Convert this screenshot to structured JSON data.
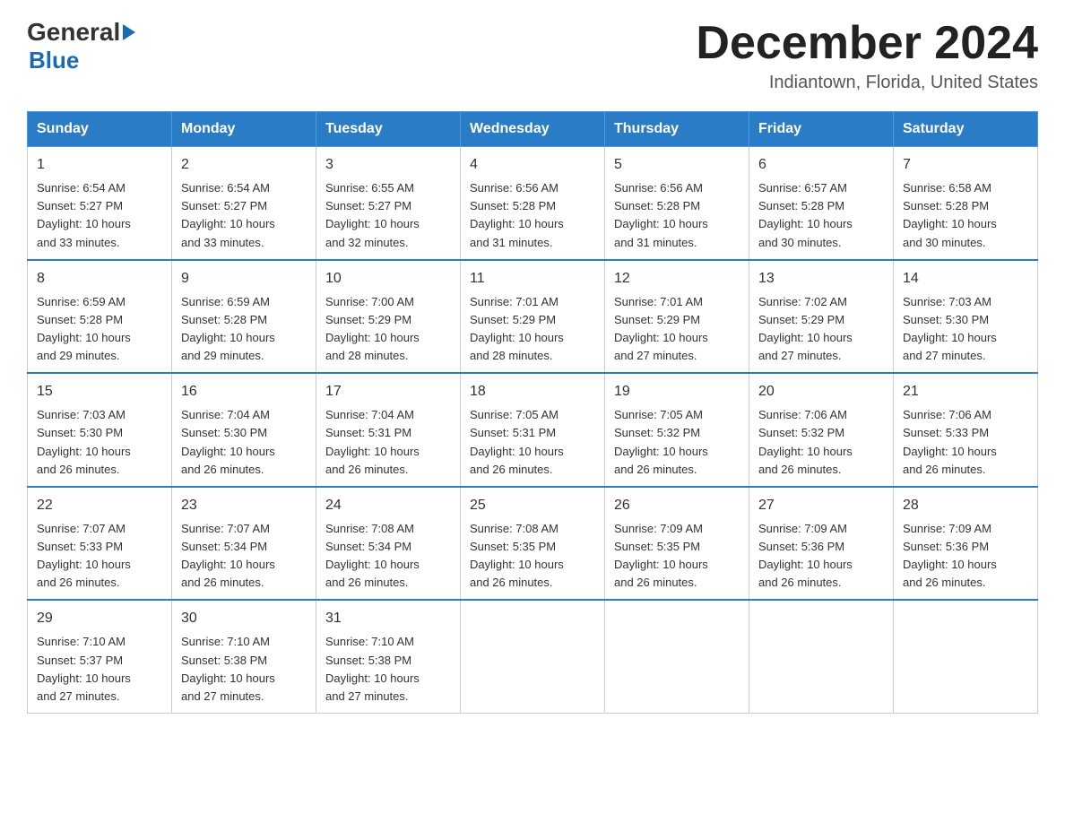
{
  "header": {
    "logo_general": "General",
    "logo_blue": "Blue",
    "month_title": "December 2024",
    "location": "Indiantown, Florida, United States"
  },
  "days_of_week": [
    "Sunday",
    "Monday",
    "Tuesday",
    "Wednesday",
    "Thursday",
    "Friday",
    "Saturday"
  ],
  "weeks": [
    [
      {
        "day": "1",
        "sunrise": "6:54 AM",
        "sunset": "5:27 PM",
        "daylight": "10 hours and 33 minutes."
      },
      {
        "day": "2",
        "sunrise": "6:54 AM",
        "sunset": "5:27 PM",
        "daylight": "10 hours and 33 minutes."
      },
      {
        "day": "3",
        "sunrise": "6:55 AM",
        "sunset": "5:27 PM",
        "daylight": "10 hours and 32 minutes."
      },
      {
        "day": "4",
        "sunrise": "6:56 AM",
        "sunset": "5:28 PM",
        "daylight": "10 hours and 31 minutes."
      },
      {
        "day": "5",
        "sunrise": "6:56 AM",
        "sunset": "5:28 PM",
        "daylight": "10 hours and 31 minutes."
      },
      {
        "day": "6",
        "sunrise": "6:57 AM",
        "sunset": "5:28 PM",
        "daylight": "10 hours and 30 minutes."
      },
      {
        "day": "7",
        "sunrise": "6:58 AM",
        "sunset": "5:28 PM",
        "daylight": "10 hours and 30 minutes."
      }
    ],
    [
      {
        "day": "8",
        "sunrise": "6:59 AM",
        "sunset": "5:28 PM",
        "daylight": "10 hours and 29 minutes."
      },
      {
        "day": "9",
        "sunrise": "6:59 AM",
        "sunset": "5:28 PM",
        "daylight": "10 hours and 29 minutes."
      },
      {
        "day": "10",
        "sunrise": "7:00 AM",
        "sunset": "5:29 PM",
        "daylight": "10 hours and 28 minutes."
      },
      {
        "day": "11",
        "sunrise": "7:01 AM",
        "sunset": "5:29 PM",
        "daylight": "10 hours and 28 minutes."
      },
      {
        "day": "12",
        "sunrise": "7:01 AM",
        "sunset": "5:29 PM",
        "daylight": "10 hours and 27 minutes."
      },
      {
        "day": "13",
        "sunrise": "7:02 AM",
        "sunset": "5:29 PM",
        "daylight": "10 hours and 27 minutes."
      },
      {
        "day": "14",
        "sunrise": "7:03 AM",
        "sunset": "5:30 PM",
        "daylight": "10 hours and 27 minutes."
      }
    ],
    [
      {
        "day": "15",
        "sunrise": "7:03 AM",
        "sunset": "5:30 PM",
        "daylight": "10 hours and 26 minutes."
      },
      {
        "day": "16",
        "sunrise": "7:04 AM",
        "sunset": "5:30 PM",
        "daylight": "10 hours and 26 minutes."
      },
      {
        "day": "17",
        "sunrise": "7:04 AM",
        "sunset": "5:31 PM",
        "daylight": "10 hours and 26 minutes."
      },
      {
        "day": "18",
        "sunrise": "7:05 AM",
        "sunset": "5:31 PM",
        "daylight": "10 hours and 26 minutes."
      },
      {
        "day": "19",
        "sunrise": "7:05 AM",
        "sunset": "5:32 PM",
        "daylight": "10 hours and 26 minutes."
      },
      {
        "day": "20",
        "sunrise": "7:06 AM",
        "sunset": "5:32 PM",
        "daylight": "10 hours and 26 minutes."
      },
      {
        "day": "21",
        "sunrise": "7:06 AM",
        "sunset": "5:33 PM",
        "daylight": "10 hours and 26 minutes."
      }
    ],
    [
      {
        "day": "22",
        "sunrise": "7:07 AM",
        "sunset": "5:33 PM",
        "daylight": "10 hours and 26 minutes."
      },
      {
        "day": "23",
        "sunrise": "7:07 AM",
        "sunset": "5:34 PM",
        "daylight": "10 hours and 26 minutes."
      },
      {
        "day": "24",
        "sunrise": "7:08 AM",
        "sunset": "5:34 PM",
        "daylight": "10 hours and 26 minutes."
      },
      {
        "day": "25",
        "sunrise": "7:08 AM",
        "sunset": "5:35 PM",
        "daylight": "10 hours and 26 minutes."
      },
      {
        "day": "26",
        "sunrise": "7:09 AM",
        "sunset": "5:35 PM",
        "daylight": "10 hours and 26 minutes."
      },
      {
        "day": "27",
        "sunrise": "7:09 AM",
        "sunset": "5:36 PM",
        "daylight": "10 hours and 26 minutes."
      },
      {
        "day": "28",
        "sunrise": "7:09 AM",
        "sunset": "5:36 PM",
        "daylight": "10 hours and 26 minutes."
      }
    ],
    [
      {
        "day": "29",
        "sunrise": "7:10 AM",
        "sunset": "5:37 PM",
        "daylight": "10 hours and 27 minutes."
      },
      {
        "day": "30",
        "sunrise": "7:10 AM",
        "sunset": "5:38 PM",
        "daylight": "10 hours and 27 minutes."
      },
      {
        "day": "31",
        "sunrise": "7:10 AM",
        "sunset": "5:38 PM",
        "daylight": "10 hours and 27 minutes."
      },
      null,
      null,
      null,
      null
    ]
  ],
  "labels": {
    "sunrise": "Sunrise:",
    "sunset": "Sunset:",
    "daylight": "Daylight:"
  }
}
